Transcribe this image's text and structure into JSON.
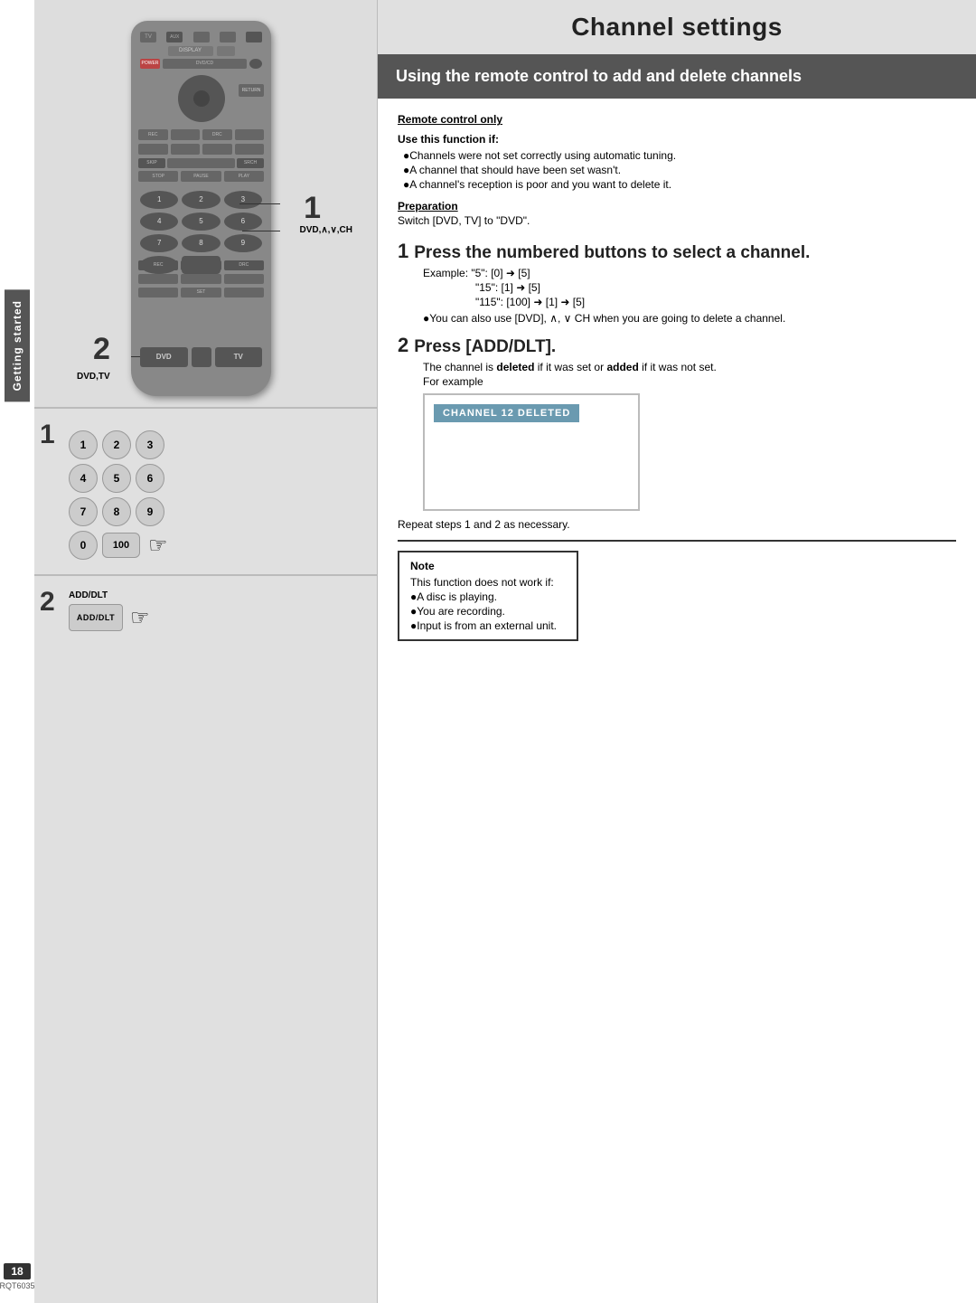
{
  "page": {
    "title": "Channel settings",
    "page_number": "18",
    "rqt_code": "RQT6035"
  },
  "sidebar": {
    "label": "Getting started"
  },
  "section_heading": "Using the remote control to add and delete channels",
  "remote_control_label": "Remote control only",
  "use_function_label": "Use this function if:",
  "bullets_use": [
    "Channels were not set correctly using automatic tuning.",
    "A channel that should have been set wasn't.",
    "A channel's reception is poor and you want to delete it."
  ],
  "preparation_label": "Preparation",
  "preparation_text": "Switch [DVD, TV] to \"DVD\".",
  "step1": {
    "number": "1",
    "title": "Press the numbered buttons to select a channel.",
    "examples": [
      "Example: \"5\": [0] ➜ [5]",
      "\"15\": [1] ➜ [5]",
      "\"115\": [100] ➜ [1] ➜ [5]"
    ],
    "note": "●You can also use [DVD], ∧, ∨ CH when you are going to delete a channel."
  },
  "step2": {
    "number": "2",
    "title": "Press [ADD/DLT].",
    "body": "The channel is deleted if it was set or added if it was not set.",
    "for_example": "For example",
    "channel_deleted_text": "CHANNEL 12 DELETED",
    "repeat_text": "Repeat steps 1 and 2 as necessary."
  },
  "note_box": {
    "title": "Note",
    "items": [
      "This function does not work if:",
      "●A disc is playing.",
      "●You are recording.",
      "●Input is from an external unit."
    ]
  },
  "left_labels": {
    "label1": "1",
    "label1_sub": "DVD,∧,∨,CH",
    "label2": "2",
    "label2_sub": "DVD,TV"
  },
  "numpad": {
    "rows": [
      [
        "1",
        "2",
        "3"
      ],
      [
        "4",
        "5",
        "6"
      ],
      [
        "7",
        "8",
        "9"
      ],
      [
        "0",
        "100",
        ""
      ]
    ]
  },
  "add_dlt": {
    "label": "ADD/DLT",
    "button_text": ""
  }
}
